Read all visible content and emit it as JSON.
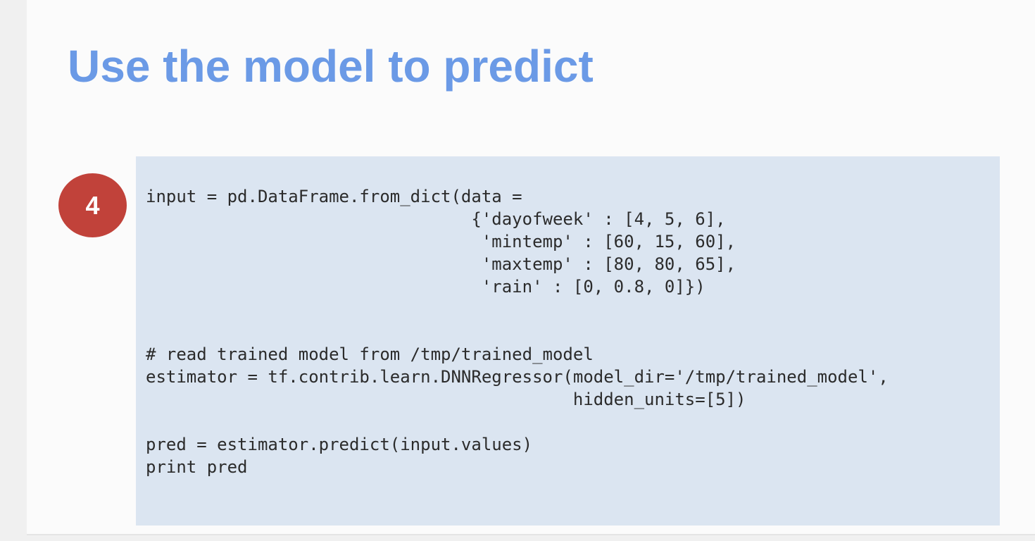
{
  "slide": {
    "title": "Use the model to predict",
    "step_number": "4",
    "code": "input = pd.DataFrame.from_dict(data =\n                                {'dayofweek' : [4, 5, 6],\n                                 'mintemp' : [60, 15, 60],\n                                 'maxtemp' : [80, 80, 65],\n                                 'rain' : [0, 0.8, 0]})\n\n\n# read trained model from /tmp/trained_model\nestimator = tf.contrib.learn.DNNRegressor(model_dir='/tmp/trained_model',\n                                          hidden_units=[5])\n\npred = estimator.predict(input.values)\nprint pred",
    "colors": {
      "title": "#6b9ae6",
      "badge": "#c1423a",
      "code_panel": "#dbe5f1"
    }
  }
}
